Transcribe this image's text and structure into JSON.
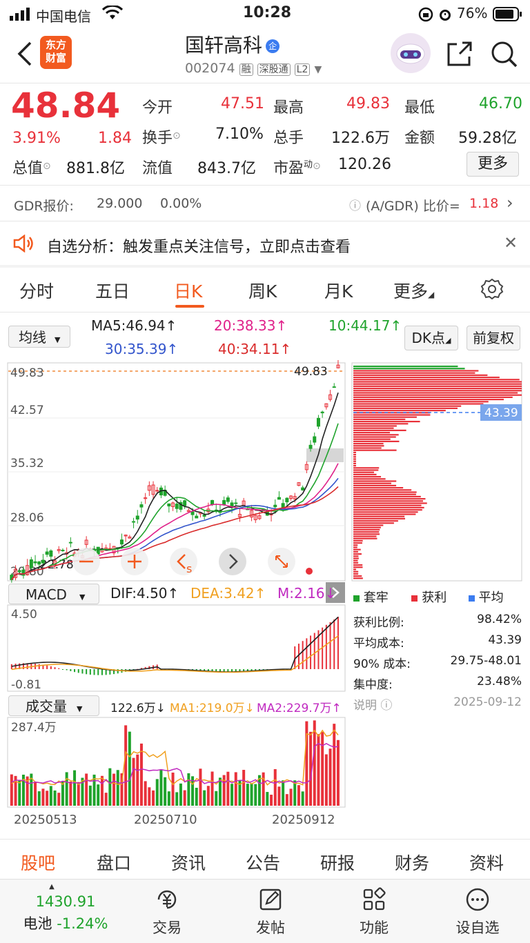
{
  "status_bar": {
    "carrier": "中国电信",
    "time": "10:28",
    "battery": "76%"
  },
  "header": {
    "logo_line1": "东方",
    "logo_line2": "财富",
    "stock_name": "国轩高科",
    "enterprise_badge": "企",
    "code": "002074",
    "tag1": "融",
    "tag2": "深股通",
    "tag3": "L2"
  },
  "quote": {
    "price": "48.84",
    "change_pct": "3.91%",
    "change": "1.84",
    "open_label": "今开",
    "open": "47.51",
    "high_label": "最高",
    "high": "49.83",
    "low_label": "最低",
    "low": "46.70",
    "turnover_label": "换手",
    "turnover": "7.10%",
    "volume_label": "总手",
    "volume": "122.6万",
    "amount_label": "金额",
    "amount": "59.28亿",
    "mktcap_label": "总值",
    "mktcap": "881.8亿",
    "float_label": "流值",
    "float": "843.7亿",
    "pe_label": "市盈",
    "pe_sup": "动",
    "pe": "120.26",
    "more_button": "更多"
  },
  "gdr": {
    "label": "GDR报价:",
    "price": "29.000",
    "pct": "0.00%",
    "ratio_label": "(A/GDR) 比价=",
    "ratio": "1.18"
  },
  "notice": {
    "text": "自选分析：触发重点关注信号，立即点击查看"
  },
  "tabs": [
    "分时",
    "五日",
    "日K",
    "周K",
    "月K",
    "更多"
  ],
  "active_tab": "日K",
  "ma": {
    "selector": "均线",
    "ma5": "MA5:46.94",
    "ma10": "10:44.17",
    "ma20": "20:38.33",
    "ma30": "30:35.39",
    "ma40": "40:34.11",
    "arrow": "↑",
    "dk_button": "DK点",
    "adjust_button": "前复权"
  },
  "kchart": {
    "y_ticks": [
      "49.83",
      "42.57",
      "35.32",
      "28.06",
      "20.80"
    ],
    "high_marker": "49.83",
    "low_marker": "22.78",
    "cost_label": "43.39"
  },
  "chip_dist": {
    "legend": [
      "套牢",
      "获利",
      "平均"
    ],
    "rows": [
      {
        "label": "获利比例:",
        "value": "98.42%"
      },
      {
        "label": "平均成本:",
        "value": "43.39"
      },
      {
        "label": "90% 成本:",
        "value": "29.75-48.01"
      },
      {
        "label": "集中度:",
        "value": "23.48%"
      }
    ],
    "note": "说明",
    "date": "2025-09-12"
  },
  "macd": {
    "selector": "MACD",
    "dif": "DIF:4.50",
    "dea": "DEA:3.42",
    "m": "M:2.16",
    "y_top": "4.50",
    "y_bottom": "-0.81"
  },
  "volume": {
    "selector": "成交量",
    "vol": "122.6万",
    "ma1": "MA1:219.0万",
    "ma2": "MA2:229.7万",
    "y_top": "287.4万",
    "dates": [
      "20250513",
      "20250710",
      "20250912"
    ]
  },
  "bottom_tabs": [
    "股吧",
    "盘口",
    "资讯",
    "公告",
    "研报",
    "财务",
    "资料"
  ],
  "nav": {
    "index_value": "1430.91",
    "index_name": "电池",
    "index_pct": "-1.24%",
    "items": [
      "交易",
      "发帖",
      "功能",
      "设自选"
    ]
  },
  "colors": {
    "up": "#e8313a",
    "down": "#1fa32c",
    "brand": "#f25a1f",
    "ma5": "#222222",
    "ma10": "#1fa32c",
    "ma20": "#e0218a",
    "ma30": "#3355cc",
    "ma40": "#d92b2b"
  }
}
